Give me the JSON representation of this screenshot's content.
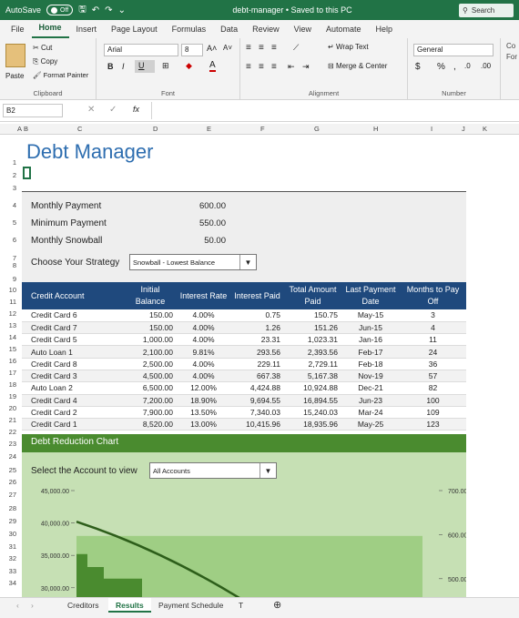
{
  "titlebar": {
    "autosave": "AutoSave",
    "toggle": "Off",
    "doc": "debt-manager • Saved to this PC",
    "search": "Search"
  },
  "menu": [
    "File",
    "Home",
    "Insert",
    "Page Layout",
    "Formulas",
    "Data",
    "Review",
    "View",
    "Automate",
    "Help"
  ],
  "ribbon": {
    "paste": "Paste",
    "cut": "Cut",
    "copy": "Copy",
    "format_painter": "Format Painter",
    "clipboard": "Clipboard",
    "font_name": "Arial",
    "font_size": "8",
    "font_group": "Font",
    "wrap": "Wrap Text",
    "merge": "Merge & Center",
    "alignment": "Alignment",
    "number_format": "General",
    "number": "Number",
    "cond": "Co",
    "form": "For"
  },
  "formula": {
    "namebox": "B2",
    "fx": "fx"
  },
  "columns": [
    "A",
    "B",
    "C",
    "D",
    "E",
    "F",
    "G",
    "H",
    "I",
    "J",
    "K"
  ],
  "rows": [
    "1",
    "2",
    "3",
    "4",
    "5",
    "6",
    "7",
    "8",
    "9",
    "10",
    "11",
    "12",
    "13",
    "14",
    "15",
    "16",
    "17",
    "18",
    "19",
    "20",
    "21",
    "22",
    "23",
    "24",
    "25",
    "26",
    "27",
    "28",
    "29",
    "30",
    "31",
    "32",
    "33",
    "34"
  ],
  "sheet": {
    "title": "Debt Manager",
    "monthly_payment_label": "Monthly Payment",
    "monthly_payment": "600.00",
    "minimum_payment_label": "Minimum Payment",
    "minimum_payment": "550.00",
    "monthly_snowball_label": "Monthly Snowball",
    "monthly_snowball": "50.00",
    "strategy_label": "Choose Your Strategy",
    "strategy_value": "Snowball - Lowest Balance",
    "headers": [
      "Credit Account",
      "Initial Balance",
      "Interest Rate",
      "Interest Paid",
      "Total Amount Paid",
      "Last Payment Date",
      "Months to Pay Off"
    ],
    "accounts": [
      [
        "Credit Card 6",
        "150.00",
        "4.00%",
        "0.75",
        "150.75",
        "May-15",
        "3"
      ],
      [
        "Credit Card 7",
        "150.00",
        "4.00%",
        "1.26",
        "151.26",
        "Jun-15",
        "4"
      ],
      [
        "Credit Card 5",
        "1,000.00",
        "4.00%",
        "23.31",
        "1,023.31",
        "Jan-16",
        "11"
      ],
      [
        "Auto Loan 1",
        "2,100.00",
        "9.81%",
        "293.56",
        "2,393.56",
        "Feb-17",
        "24"
      ],
      [
        "Credit Card 8",
        "2,500.00",
        "4.00%",
        "229.11",
        "2,729.11",
        "Feb-18",
        "36"
      ],
      [
        "Credit Card 3",
        "4,500.00",
        "4.00%",
        "667.38",
        "5,167.38",
        "Nov-19",
        "57"
      ],
      [
        "Auto Loan 2",
        "6,500.00",
        "12.00%",
        "4,424.88",
        "10,924.88",
        "Dec-21",
        "82"
      ],
      [
        "Credit Card 4",
        "7,200.00",
        "18.90%",
        "9,694.55",
        "16,894.55",
        "Jun-23",
        "100"
      ],
      [
        "Credit Card 2",
        "7,900.00",
        "13.50%",
        "7,340.03",
        "15,240.03",
        "Mar-24",
        "109"
      ],
      [
        "Credit Card 1",
        "8,520.00",
        "13.00%",
        "10,415.96",
        "18,935.96",
        "May-25",
        "123"
      ]
    ],
    "chart_title": "Debt Reduction Chart",
    "view_label": "Select the Account to view",
    "view_value": "All Accounts"
  },
  "chart_data": {
    "type": "area",
    "yleft_ticks": [
      "45,000.00",
      "40,000.00",
      "35,000.00",
      "30,000.00"
    ],
    "yright_ticks": [
      "700.00",
      "600.00",
      "500.00"
    ],
    "ylim_left": [
      28000,
      45000
    ],
    "ylim_right": [
      450,
      700
    ]
  },
  "tabs": [
    "Creditors",
    "Results",
    "Payment Schedule",
    "T"
  ],
  "colors": {
    "excel_green": "#217346",
    "header_blue": "#1f497d",
    "chart_green": "#4a8b2f"
  }
}
